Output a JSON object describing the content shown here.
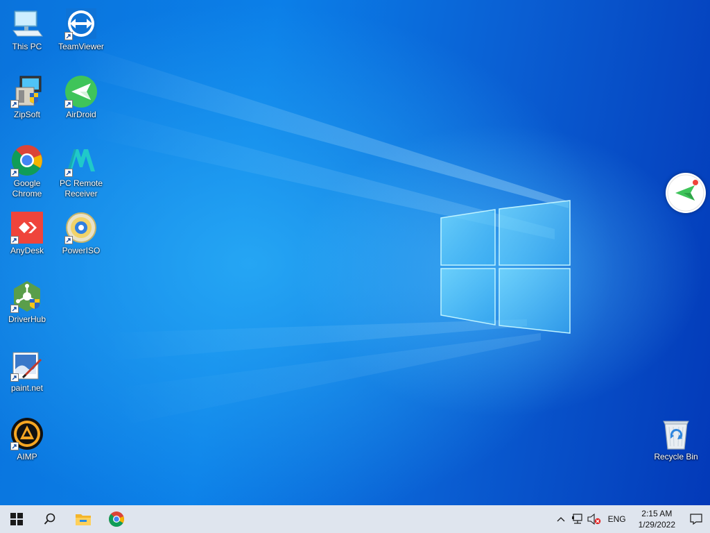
{
  "desktop": {
    "icons": [
      {
        "label": "This PC",
        "icon": "this-pc-icon"
      },
      {
        "label": "TeamViewer",
        "icon": "teamviewer-icon"
      },
      {
        "label": "ZipSoft",
        "icon": "zipsoft-icon"
      },
      {
        "label": "AirDroid",
        "icon": "airdroid-icon"
      },
      {
        "label": "Google Chrome",
        "icon": "chrome-icon"
      },
      {
        "label": "PC Remote Receiver",
        "icon": "pc-remote-receiver-icon"
      },
      {
        "label": "AnyDesk",
        "icon": "anydesk-icon"
      },
      {
        "label": "PowerISO",
        "icon": "poweriso-icon"
      },
      {
        "label": "DriverHub",
        "icon": "driverhub-icon"
      },
      {
        "label": "paint.net",
        "icon": "paint-net-icon"
      },
      {
        "label": "AIMP",
        "icon": "aimp-icon"
      },
      {
        "label": "Recycle Bin",
        "icon": "recycle-bin-icon"
      }
    ],
    "floating_widget": {
      "icon": "airdroid-floating-icon"
    }
  },
  "taskbar": {
    "start": {
      "icon": "windows-start-icon"
    },
    "search": {
      "icon": "search-icon"
    },
    "pinned": [
      {
        "icon": "file-explorer-icon"
      },
      {
        "icon": "chrome-icon"
      }
    ],
    "tray": {
      "chevron": "chevron-up-icon",
      "network": "network-icon",
      "volume": "volume-muted-icon",
      "language": "ENG",
      "time": "2:15 AM",
      "date": "1/29/2022",
      "notifications": "notification-icon"
    }
  },
  "colors": {
    "taskbar_bg": "#dfe5ee",
    "desktop_blue": "#0b7fe8",
    "anydesk_red": "#ef443b",
    "airdroid_green": "#3fc45a"
  }
}
